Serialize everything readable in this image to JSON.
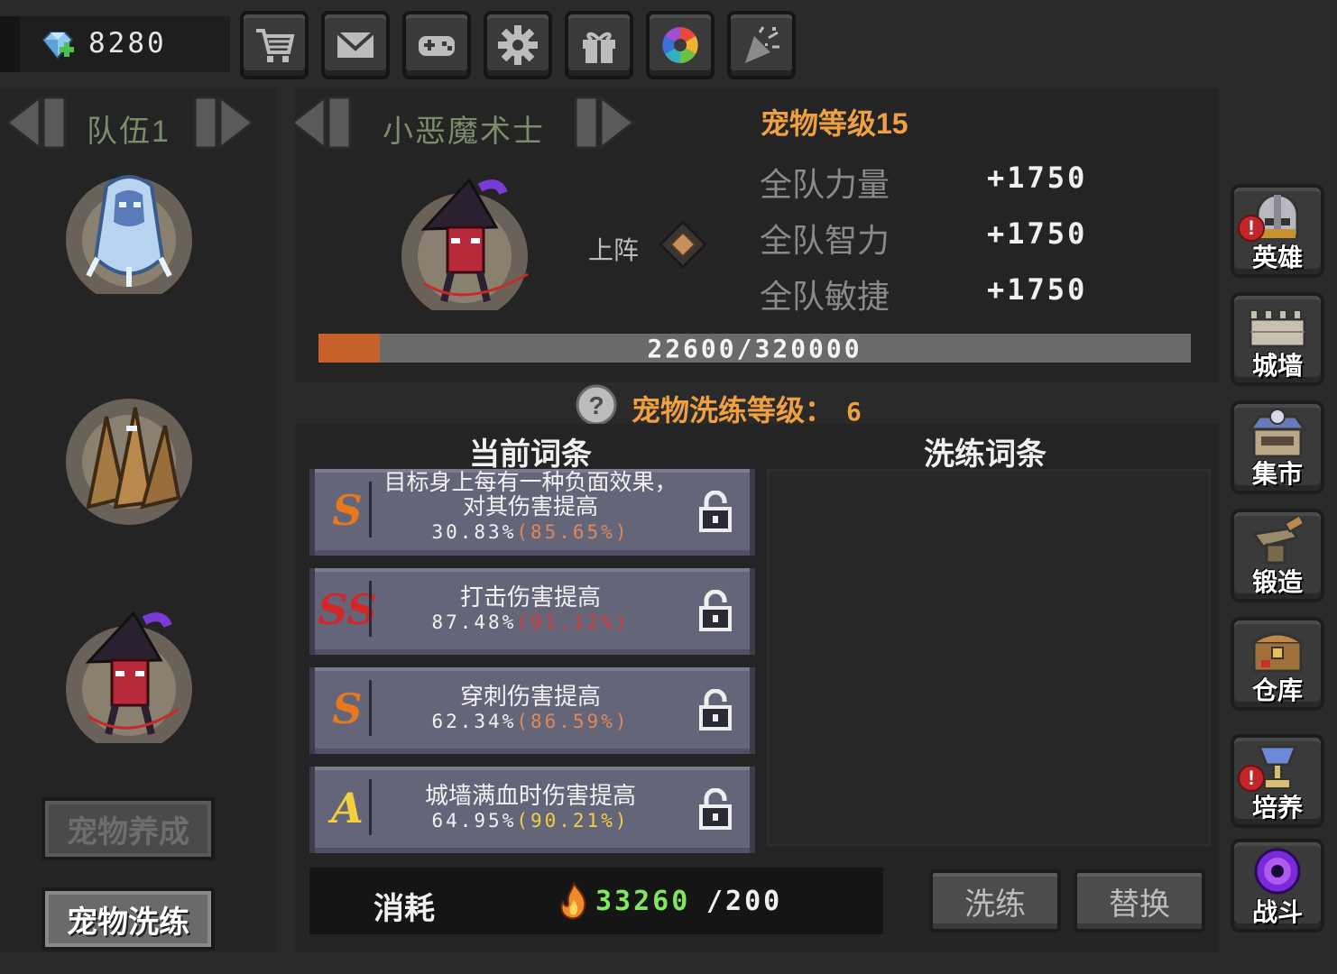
{
  "currency": {
    "icon": "gem-plus-icon",
    "value": "8280"
  },
  "toolbar": [
    {
      "name": "shop-cart-icon"
    },
    {
      "name": "mail-icon"
    },
    {
      "name": "gamepad-icon"
    },
    {
      "name": "settings-gear-icon"
    },
    {
      "name": "gift-icon"
    },
    {
      "name": "color-wheel-icon"
    },
    {
      "name": "party-popper-icon"
    }
  ],
  "team": {
    "label": "队伍1",
    "slots": [
      "ice-spirit-pet",
      "wood-golem-pet",
      "little-demon-magician-pet"
    ],
    "raise_button": "宠物养成",
    "refine_button": "宠物洗练"
  },
  "pet": {
    "name": "小恶魔术士",
    "level_label": "宠物等级15",
    "deploy_label": "上阵",
    "stats": [
      {
        "name": "全队力量",
        "value": "+1750"
      },
      {
        "name": "全队智力",
        "value": "+1750"
      },
      {
        "name": "全队敏捷",
        "value": "+1750"
      }
    ],
    "xp": {
      "text": "22600/320000",
      "fraction": 0.0706
    }
  },
  "refine": {
    "level_label": "宠物洗练等级：",
    "level_value": "6",
    "current_header": "当前词条",
    "new_header": "洗练词条",
    "affixes": [
      {
        "grade": "S",
        "grade_color": "#e8781e",
        "text": "目标身上每有一种负面效果，对其伤害提高",
        "current": "30.83%",
        "max": "(85.65%)",
        "max_color": "#e08858"
      },
      {
        "grade": "SS",
        "grade_color": "#d02828",
        "text": "打击伤害提高",
        "current": "87.48%",
        "max": "(91.12%)",
        "max_color": "#d83a3a"
      },
      {
        "grade": "S",
        "grade_color": "#e8781e",
        "text": "穿刺伤害提高",
        "current": "62.34%",
        "max": "(86.59%)",
        "max_color": "#e08858"
      },
      {
        "grade": "A",
        "grade_color": "#f0d040",
        "text": "城墙满血时伤害提高",
        "current": "64.95%",
        "max": "(90.21%)",
        "max_color": "#f0d040"
      }
    ],
    "cost_label": "消耗",
    "cost_have": "33260",
    "cost_need": "/200",
    "refine_button": "洗练",
    "replace_button": "替换"
  },
  "nav": [
    {
      "label": "英雄",
      "icon": "hero-helmet-icon",
      "alert": "!"
    },
    {
      "label": "城墙",
      "icon": "city-wall-icon"
    },
    {
      "label": "集市",
      "icon": "market-shop-icon"
    },
    {
      "label": "锻造",
      "icon": "forge-anvil-icon"
    },
    {
      "label": "仓库",
      "icon": "warehouse-chest-icon"
    },
    {
      "label": "培养",
      "icon": "train-chalice-icon",
      "alert": "!"
    },
    {
      "label": "战斗",
      "icon": "battle-portal-icon"
    }
  ]
}
